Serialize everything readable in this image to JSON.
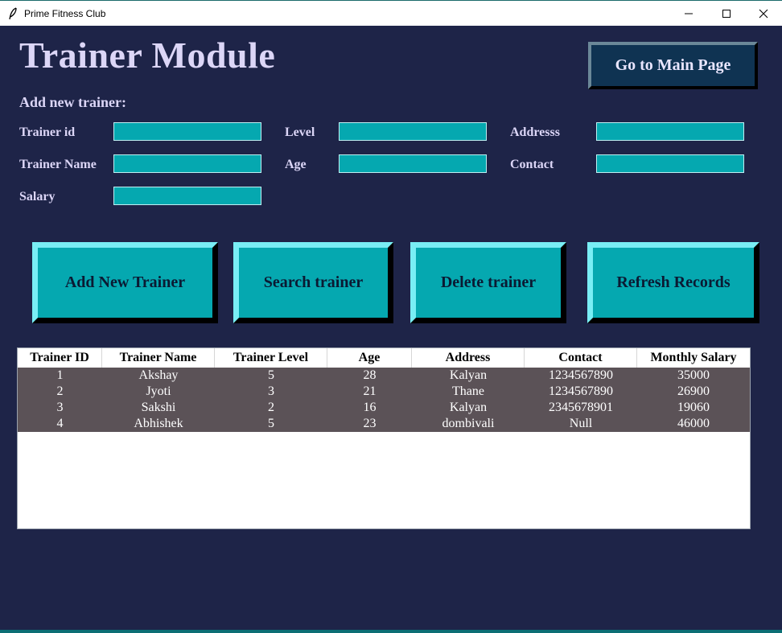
{
  "window": {
    "title": "Prime Fitness Club",
    "controls": [
      "minimize-icon",
      "maximize-icon",
      "close-icon"
    ]
  },
  "page": {
    "title": "Trainer Module",
    "main_page_button": "Go to Main Page",
    "section_heading": "Add new trainer:"
  },
  "form": {
    "trainer_id": {
      "label": "Trainer id",
      "value": ""
    },
    "trainer_name": {
      "label": "Trainer Name",
      "value": ""
    },
    "salary": {
      "label": "Salary",
      "value": ""
    },
    "level": {
      "label": "Level",
      "value": ""
    },
    "age": {
      "label": "Age",
      "value": ""
    },
    "address": {
      "label": "Addresss",
      "value": ""
    },
    "contact": {
      "label": "Contact",
      "value": ""
    }
  },
  "actions": {
    "add": "Add New Trainer",
    "search": "Search trainer",
    "delete": "Delete trainer",
    "refresh": "Refresh Records"
  },
  "table": {
    "columns": [
      "Trainer ID",
      "Trainer Name",
      "Trainer Level",
      "Age",
      "Address",
      "Contact",
      "Monthly Salary"
    ],
    "rows": [
      [
        "1",
        "Akshay",
        "5",
        "28",
        "Kalyan",
        "1234567890",
        "35000"
      ],
      [
        "2",
        "Jyoti",
        "3",
        "21",
        "Thane",
        "1234567890",
        "26900"
      ],
      [
        "3",
        "Sakshi",
        "2",
        "16",
        "Kalyan",
        "2345678901",
        "19060"
      ],
      [
        "4",
        "Abhishek",
        "5",
        "23",
        "dombivali",
        "Null",
        "46000"
      ]
    ]
  },
  "colors": {
    "background": "#1e2448",
    "accent": "#05a8b0",
    "label_text": "#dcd6f7",
    "row_background": "#5b5257"
  }
}
